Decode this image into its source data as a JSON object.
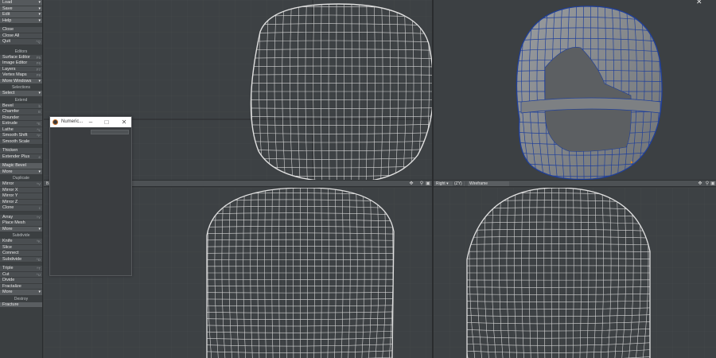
{
  "toolbar": {
    "file_group": [
      {
        "label": "Load",
        "dd": true
      },
      {
        "label": "Save",
        "dd": true
      },
      {
        "label": "Edit",
        "dd": true
      },
      {
        "label": "Help",
        "dd": true
      }
    ],
    "file_actions": [
      {
        "label": "Close",
        "shortcut": ""
      },
      {
        "label": "Close All",
        "shortcut": ""
      },
      {
        "label": "Quit",
        "shortcut": "^Q"
      }
    ],
    "editors_header": "Editors",
    "editors": [
      {
        "label": "Surface Editor",
        "shortcut": "F5"
      },
      {
        "label": "Image Editor",
        "shortcut": "F6"
      },
      {
        "label": "Layers",
        "shortcut": "F7"
      },
      {
        "label": "Vertex Maps",
        "shortcut": "F8"
      }
    ],
    "more_windows": "More Windows",
    "selections_header": "Selections",
    "select_dd": "Select",
    "extend_header": "Extend",
    "extend": [
      {
        "label": "Bevel",
        "shortcut": "b"
      },
      {
        "label": "Chamfer",
        "shortcut": "B"
      },
      {
        "label": "Rounder",
        "shortcut": ""
      },
      {
        "label": "Extrude",
        "shortcut": "^E"
      },
      {
        "label": "Lathe",
        "shortcut": "^L"
      },
      {
        "label": "Smooth Shift",
        "shortcut": "^F"
      },
      {
        "label": "Smooth Scale",
        "shortcut": ""
      }
    ],
    "extend2": [
      {
        "label": "Thicken",
        "shortcut": ""
      },
      {
        "label": "Extender Plus",
        "shortcut": "e"
      }
    ],
    "magic_bevel": "Magic Bevel",
    "more1": "More",
    "duplicate_header": "Duplicate",
    "duplicate": [
      {
        "label": "Mirror",
        "shortcut": "^V"
      },
      {
        "label": "Mirror X",
        "shortcut": ""
      },
      {
        "label": "Mirror Y",
        "shortcut": ""
      },
      {
        "label": "Mirror Z",
        "shortcut": ""
      },
      {
        "label": "Clone",
        "shortcut": "c"
      }
    ],
    "duplicate2": [
      {
        "label": "Array",
        "shortcut": "^Y"
      },
      {
        "label": "Place Mesh",
        "shortcut": ""
      }
    ],
    "more2": "More",
    "subdivide_header": "Subdivide",
    "subdivide": [
      {
        "label": "Knife",
        "shortcut": "^K"
      },
      {
        "label": "Slice",
        "shortcut": ""
      },
      {
        "label": "Connect",
        "shortcut": ""
      },
      {
        "label": "Subdivide",
        "shortcut": "^D"
      }
    ],
    "subdivide2": [
      {
        "label": "Triple",
        "shortcut": "^T"
      },
      {
        "label": "Cut",
        "shortcut": "^U"
      },
      {
        "label": "Divide",
        "shortcut": ""
      },
      {
        "label": "Fractalize",
        "shortcut": ""
      }
    ],
    "more3": "More",
    "destroy_header": "Destroy",
    "destroy": [
      {
        "label": "Fracture",
        "shortcut": ""
      }
    ]
  },
  "viewport_bar_left": {
    "label": "Ba"
  },
  "viewport_bar_right": {
    "view": "Right",
    "axis": "(ZY)",
    "mode": "Wireframe"
  },
  "numeric_panel": {
    "title": "Numeric..."
  },
  "colors": {
    "wire": "#d6d6d6",
    "mesh_blue": "#1f3f9a",
    "mesh_fill": "#8a8d90",
    "bg": "#3d4144"
  }
}
